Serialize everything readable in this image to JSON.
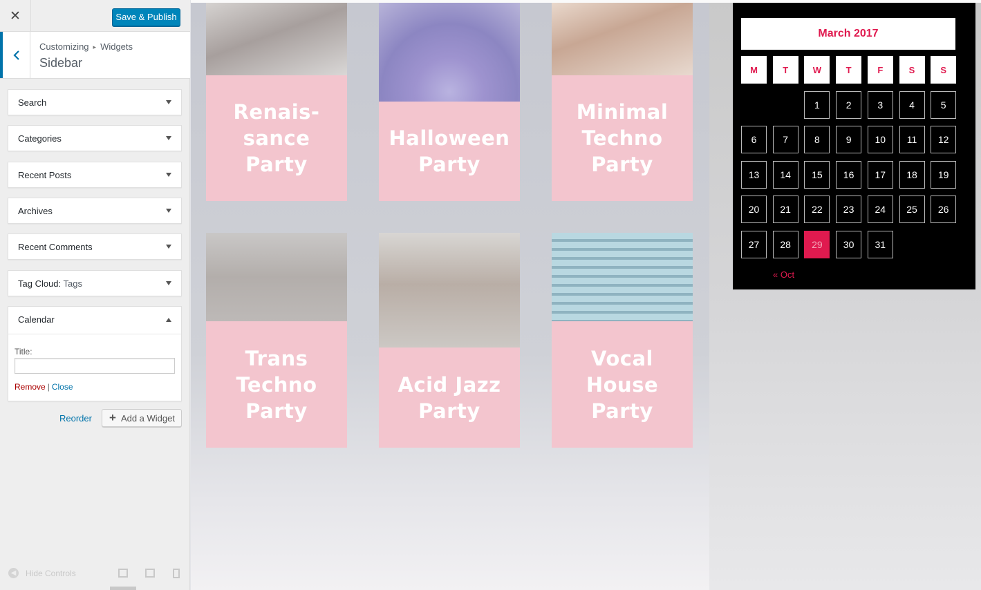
{
  "topbar": {
    "close_glyph": "✕",
    "publish_label": "Save & Publish"
  },
  "breadcrumb": {
    "root": "Customizing",
    "separator": "▸",
    "current": "Widgets"
  },
  "section_title": "Sidebar",
  "widgets": [
    {
      "label": "Search",
      "sub": ""
    },
    {
      "label": "Categories",
      "sub": ""
    },
    {
      "label": "Recent Posts",
      "sub": ""
    },
    {
      "label": "Archives",
      "sub": ""
    },
    {
      "label": "Recent Comments",
      "sub": ""
    },
    {
      "label": "Tag Cloud:",
      "sub": "Tags"
    }
  ],
  "calendar_widget": {
    "label": "Calendar",
    "title_field_label": "Title:",
    "title_value": "",
    "remove_label": "Remove",
    "separator": "|",
    "close_label": "Close"
  },
  "actions": {
    "reorder_label": "Reorder",
    "add_widget_label": "Add a Widget"
  },
  "footer": {
    "hide_controls_label": "Hide Controls"
  },
  "events": [
    {
      "title": "Renais-\nsance\nParty"
    },
    {
      "title": "Halloween\nParty"
    },
    {
      "title": "Minimal\nTechno\nParty"
    },
    {
      "title": "Trans\nTechno\nParty"
    },
    {
      "title": "Acid Jazz\nParty"
    },
    {
      "title": "Vocal\nHouse\nParty"
    }
  ],
  "calendar": {
    "caption": "March 2017",
    "weekdays": [
      "M",
      "T",
      "W",
      "T",
      "F",
      "S",
      "S"
    ],
    "first_weekday_index": 2,
    "days_in_month": 31,
    "today": 29,
    "prev_link": "« Oct",
    "accent_color": "#e01a4f"
  },
  "colors": {
    "publish_button": "#0085ba",
    "event_panel": "#f3c5ce",
    "link": "#0073aa"
  }
}
